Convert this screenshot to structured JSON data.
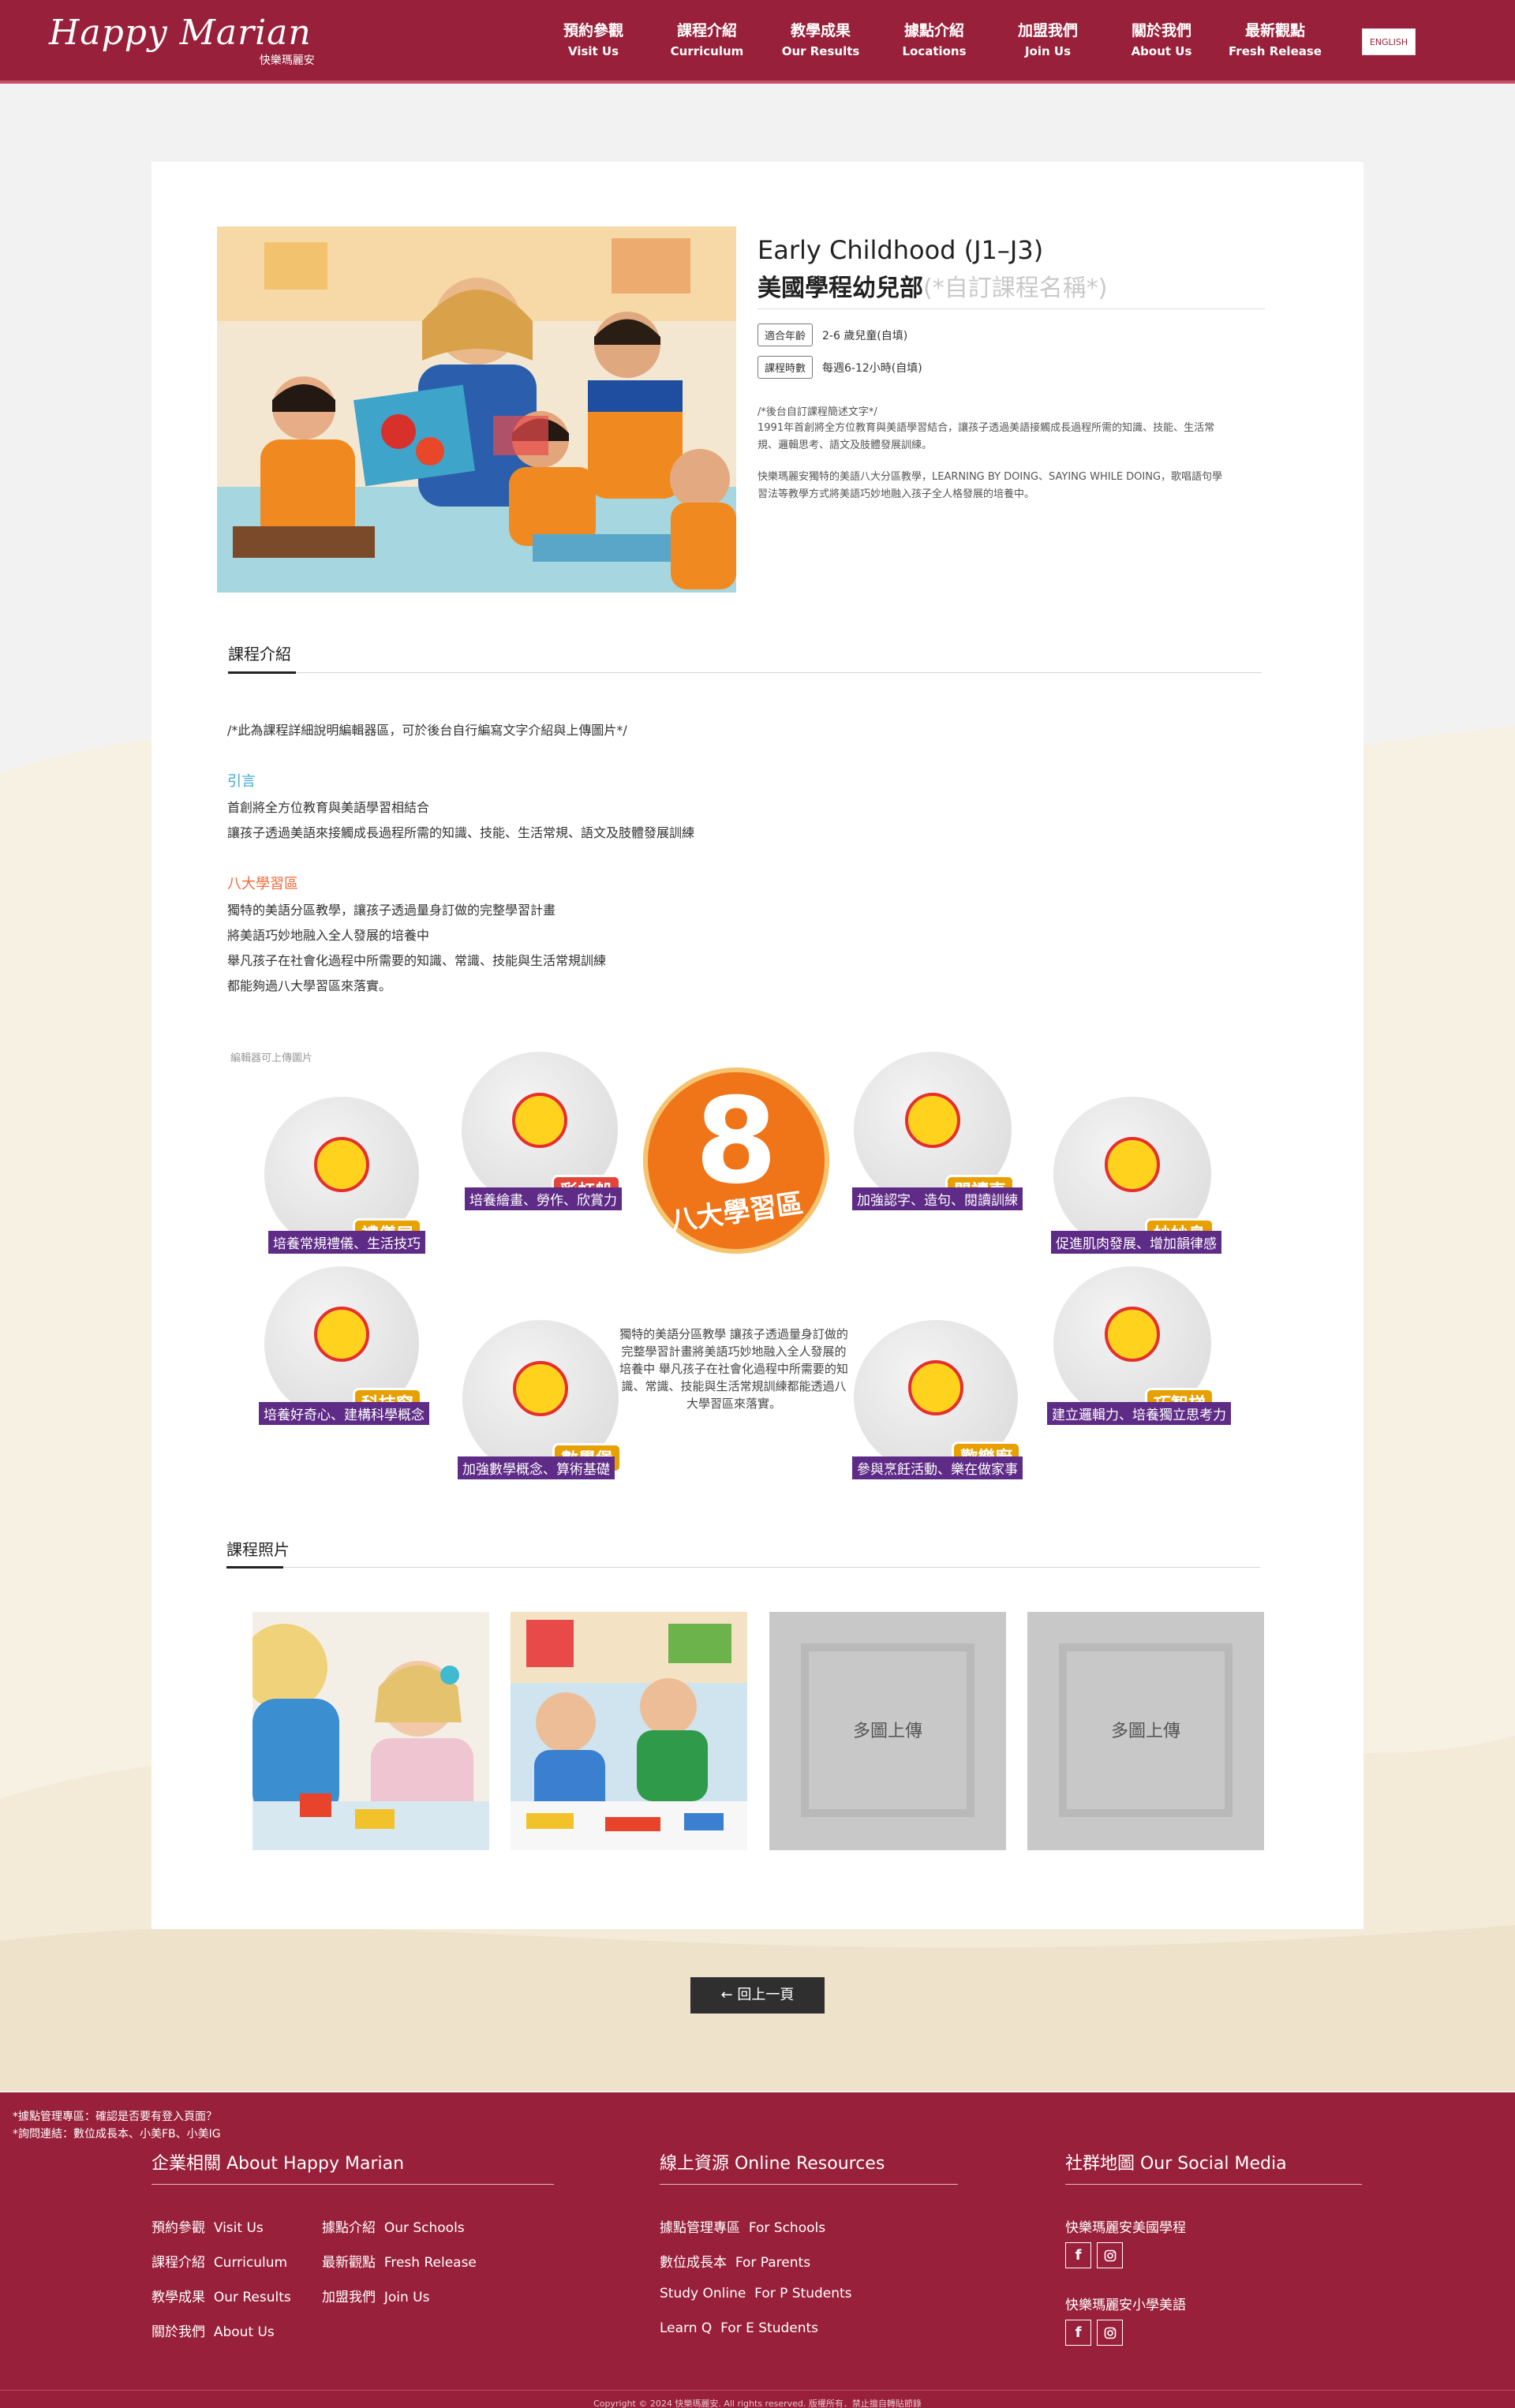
{
  "header": {
    "logo_script": "Happy Marian",
    "logo_sub": "快樂瑪麗安",
    "nav": [
      {
        "zh": "預約參觀",
        "en": "Visit Us"
      },
      {
        "zh": "課程介紹",
        "en": "Curriculum"
      },
      {
        "zh": "教學成果",
        "en": "Our Results"
      },
      {
        "zh": "據點介紹",
        "en": "Locations"
      },
      {
        "zh": "加盟我們",
        "en": "Join Us"
      },
      {
        "zh": "關於我們",
        "en": "About Us"
      },
      {
        "zh": "最新觀點",
        "en": "Fresh Release"
      }
    ],
    "lang_button": "ENGLISH"
  },
  "course": {
    "title_en": "Early Childhood (J1–J3)",
    "title_zh": "美國學程幼兒部",
    "title_placeholder": "(*自訂課程名稱*)",
    "meta": [
      {
        "tag": "適合年齡",
        "value": "2-6 歲兒童(自填)"
      },
      {
        "tag": "課程時數",
        "value": "每週6-12小時(自填)"
      }
    ],
    "desc1": "/*後台自訂課程簡述文字*/",
    "desc2": "1991年首創將全方位教育與美語學習結合，讓孩子透過美語接觸成長過程所需的知識、技能、生活常規、邏輯思考、語文及肢體發展訓練。",
    "desc3": "快樂瑪麗安獨特的美語八大分區教學，LEARNING BY DOING、SAYING WHILE DOING，歌唱語句學習法等教學方式將美語巧妙地融入孩子全人格發展的培養中。"
  },
  "intro": {
    "title": "課程介紹",
    "editor_note": "/*此為課程詳細說明編輯器區，可於後台自行編寫文字介紹與上傳圖片*/",
    "head1": "引言",
    "head1_lines": [
      "首創將全方位教育與美語學習相結合",
      "讓孩子透過美語來接觸成長過程所需的知識、技能、生活常規、語文及肢體發展訓練"
    ],
    "head2": "八大學習區",
    "head2_lines": [
      "獨特的美語分區教學，讓孩子透過量身訂做的完整學習計畫",
      "將美語巧妙地融入全人發展的培養中",
      "舉凡孩子在社會化過程中所需要的知識、常識、技能與生活常規訓練",
      "都能夠過八大學習區來落實。"
    ],
    "upload_note": "編輯器可上傳圖片"
  },
  "zones": {
    "center_number": "8",
    "center_label": "八大學習區",
    "center_text": "獨特的美語分區教學\n讓孩子透過量身訂做的完整學習計畫將美語巧妙地融入全人發展的培養中\n舉凡孩子在社會化過程中所需要的知識、常識、技能與生活常規訓練都能透過八大學習區來落實。",
    "items": [
      {
        "name": "禮儀屋",
        "caption": "培養常規禮儀、生活技巧"
      },
      {
        "name": "彩虹船",
        "caption": "培養繪畫、勞作、欣賞力"
      },
      {
        "name": "閱讀車",
        "caption": "加強認字、造句、閱讀訓練"
      },
      {
        "name": "妙妙島",
        "caption": "促進肌肉發展、增加韻律感"
      },
      {
        "name": "科技窗",
        "caption": "培養好奇心、建構科學概念"
      },
      {
        "name": "數學堡",
        "caption": "加強數學概念、算術基礎"
      },
      {
        "name": "歡樂廚",
        "caption": "參與烹飪活動、樂在做家事"
      },
      {
        "name": "巧智梯",
        "caption": "建立邏輯力、培養獨立思考力"
      }
    ]
  },
  "photos": {
    "title": "課程照片",
    "placeholder_label": "多圖上傳"
  },
  "back_button": "← 回上一頁",
  "footer": {
    "admin_note_1": "*據點管理專區：確認是否要有登入頁面？",
    "admin_note_2": "*詢問連結：數位成長本、小美FB、小美IG",
    "col1_title": "企業相關 About Happy Marian",
    "col1_links": [
      {
        "zh": "預約參觀",
        "en": "Visit Us"
      },
      {
        "zh": "據點介紹",
        "en": "Our Schools"
      },
      {
        "zh": "課程介紹",
        "en": "Curriculum"
      },
      {
        "zh": "最新觀點",
        "en": "Fresh Release"
      },
      {
        "zh": "教學成果",
        "en": "Our Results"
      },
      {
        "zh": "加盟我們",
        "en": "Join Us"
      },
      {
        "zh": "關於我們",
        "en": "About Us"
      }
    ],
    "col2_title": "線上資源 Online Resources",
    "col2_links": [
      {
        "zh": "據點管理專區",
        "en": "For Schools"
      },
      {
        "zh": "數位成長本",
        "en": "For Parents"
      },
      {
        "zh": "Study Online",
        "en": "For P Students"
      },
      {
        "zh": "Learn Q",
        "en": "For E Students"
      }
    ],
    "col3_title": "社群地圖 Our Social Media",
    "social_groups": [
      "快樂瑪麗安美國學程",
      "快樂瑪麗安小學美語"
    ],
    "copyright": "Copyright © 2024 快樂瑪麗安. All rights reserved. 版權所有．禁止擅自轉貼節錄"
  },
  "colors": {
    "brand": "#98203a",
    "accent_blue": "#3aa6d8",
    "accent_orange": "#f06a3a"
  }
}
